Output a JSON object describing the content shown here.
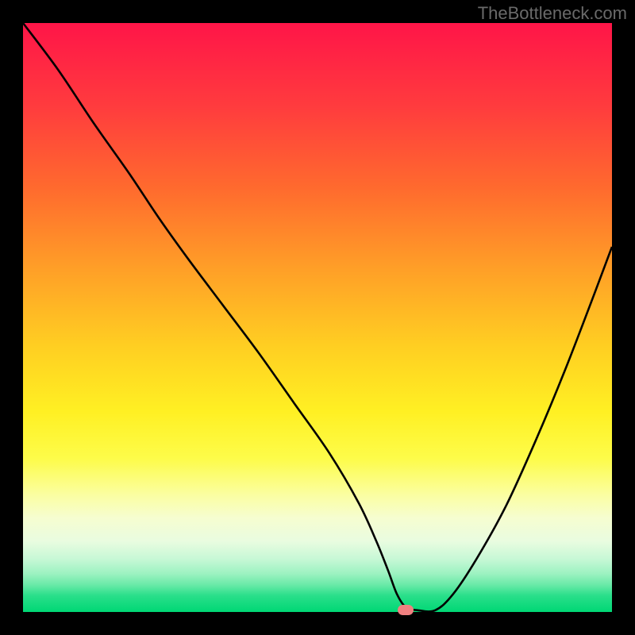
{
  "watermark": "TheBottleneck.com",
  "chart_data": {
    "type": "line",
    "title": "",
    "xlabel": "",
    "ylabel": "",
    "xlim": [
      0,
      100
    ],
    "ylim": [
      0,
      100
    ],
    "x": [
      0,
      6,
      12,
      18,
      23,
      28,
      34,
      40,
      46,
      52,
      57,
      60,
      62,
      63.5,
      65,
      67,
      70,
      73,
      77,
      82,
      87,
      92,
      97,
      100
    ],
    "values": [
      100,
      92,
      83,
      74.5,
      67,
      60,
      52,
      44,
      35.5,
      27,
      18.5,
      12,
      7,
      3,
      0.8,
      0.3,
      0.3,
      3,
      9,
      18,
      29,
      41,
      54,
      62
    ],
    "marker": {
      "x": 65,
      "y": 0.3
    },
    "gradient_stops": [
      {
        "offset": 0,
        "color": "#ff1548"
      },
      {
        "offset": 14,
        "color": "#ff3b3e"
      },
      {
        "offset": 28,
        "color": "#ff6a2e"
      },
      {
        "offset": 42,
        "color": "#ffa027"
      },
      {
        "offset": 55,
        "color": "#ffcf22"
      },
      {
        "offset": 66,
        "color": "#fff023"
      },
      {
        "offset": 74,
        "color": "#fdfc4a"
      },
      {
        "offset": 80,
        "color": "#fbfea0"
      },
      {
        "offset": 84,
        "color": "#f6fdd0"
      },
      {
        "offset": 88,
        "color": "#e9fce0"
      },
      {
        "offset": 91,
        "color": "#c7f8d6"
      },
      {
        "offset": 93.5,
        "color": "#9cf2c1"
      },
      {
        "offset": 95.5,
        "color": "#66e9a6"
      },
      {
        "offset": 97.2,
        "color": "#2adf8a"
      },
      {
        "offset": 100,
        "color": "#00d775"
      }
    ]
  }
}
